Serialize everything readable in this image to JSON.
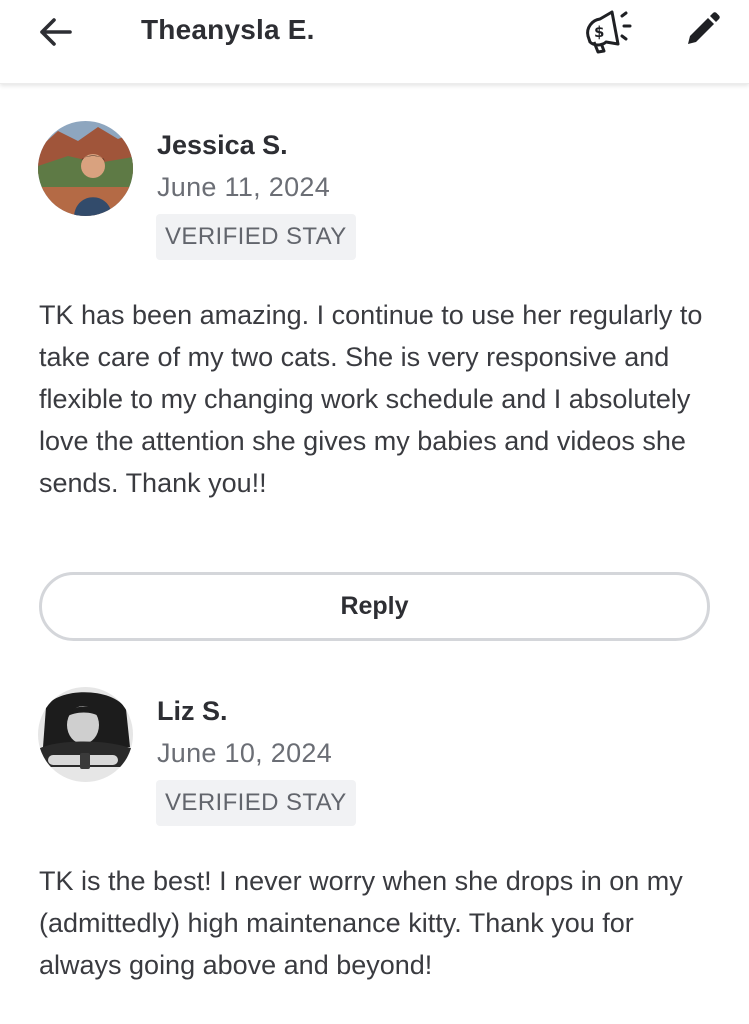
{
  "header": {
    "title": "Theanysla E.",
    "back_icon": "arrow-left-icon",
    "promo_icon": "megaphone-dollar-icon",
    "edit_icon": "pencil-icon"
  },
  "reviews": [
    {
      "name": "Jessica S.",
      "date": "June 11, 2024",
      "badge": "VERIFIED STAY",
      "text": "TK has been amazing. I continue to use her regularly to take care of my two cats. She is very responsive and flexible to my changing work schedule and I absolutely love the attention she gives my babies and videos she sends. Thank you!!",
      "reply_label": "Reply"
    },
    {
      "name": "Liz S.",
      "date": "June 10, 2024",
      "badge": "VERIFIED STAY",
      "text": "TK is the best! I never worry when she drops in on my (admittedly) high maintenance kitty. Thank you for always going above and beyond!"
    }
  ],
  "colors": {
    "text_primary": "#2d2e33",
    "text_secondary": "#6b6e75",
    "badge_bg": "#f1f2f4",
    "button_border": "#d4d6da"
  }
}
